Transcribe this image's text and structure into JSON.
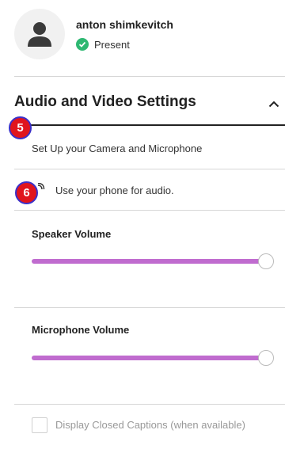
{
  "user": {
    "name": "anton shimkevitch",
    "status": "Present",
    "status_color": "#2eb872"
  },
  "section": {
    "title": "Audio and Video Settings",
    "expanded": true
  },
  "badges": {
    "step_5": "5",
    "step_6": "6"
  },
  "settings": {
    "setup_link": "Set Up your Camera and Microphone",
    "phone_audio": "Use your phone for audio.",
    "speaker_label": "Speaker Volume",
    "speaker_level": 1.0,
    "mic_label": "Microphone Volume",
    "mic_level": 1.0,
    "slider_color": "#c06ccf",
    "captions_label": "Display Closed Captions (when available)",
    "captions_checked": false
  },
  "icons": [
    "avatar-person-icon",
    "check-circle-icon",
    "chevron-up-icon",
    "phone-audio-icon"
  ]
}
